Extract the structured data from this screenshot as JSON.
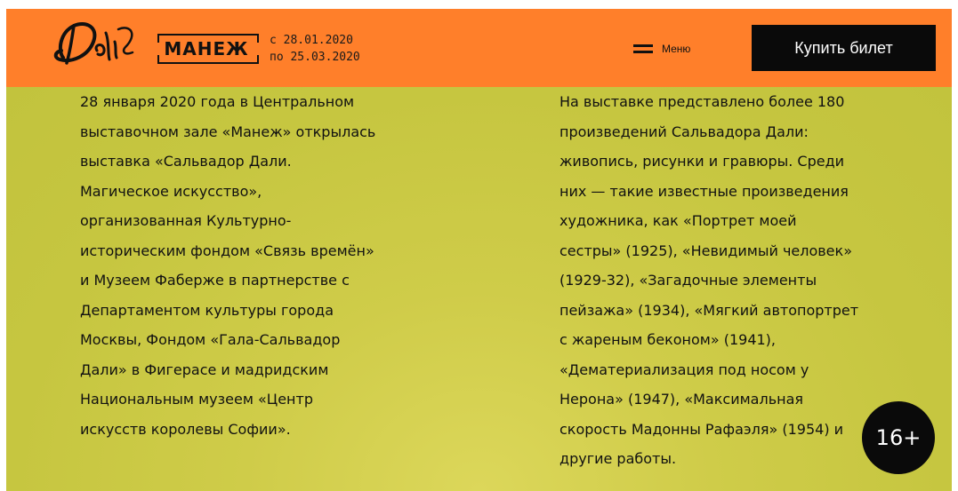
{
  "header": {
    "logo_alt": "Dali",
    "venue": "МАНЕЖ",
    "date_from": "с 28.01.2020",
    "date_to": "по 25.03.2020",
    "menu_label": "Меню",
    "menu_icon": "hamburger-icon",
    "buy_button": "Купить билет",
    "colors": {
      "background": "#ff7f2a",
      "button": "#0a0a0a",
      "button_text": "#ffffff"
    }
  },
  "content": {
    "colors": {
      "background": "#c6c640",
      "text": "#111111"
    },
    "left_column": [
      "28 января 2020 года в Центральном",
      "выставочном зале «Манеж» открылась",
      "выставка «Сальвадор Дали.",
      "Магическое искусство»,",
      "организованная Культурно-",
      "историческим фондом «Связь времён»",
      "и Музеем Фаберже в партнерстве с",
      "Департаментом культуры города",
      "Москвы, Фондом «Гала-Сальвадор",
      "Дали» в Фигерасе и мадридским",
      "Национальным музеем «Центр",
      "искусств королевы Софии»."
    ],
    "right_column": [
      "На выставке представлено более 180",
      "произведений Сальвадора Дали:",
      "живопись, рисунки и гравюры. Среди",
      "них — такие известные произведения",
      "художника, как «Портрет моей",
      "сестры» (1925), «Невидимый человек»",
      "(1929-32), «Загадочные элементы",
      "пейзажа» (1934), «Мягкий автопортрет",
      "с жареным беконом» (1941),",
      "«Дематериализация под носом у",
      "Нерона» (1947), «Максимальная",
      "скорость Мадонны Рафаэля» (1954) и",
      "другие работы."
    ]
  },
  "age_badge": "16+"
}
